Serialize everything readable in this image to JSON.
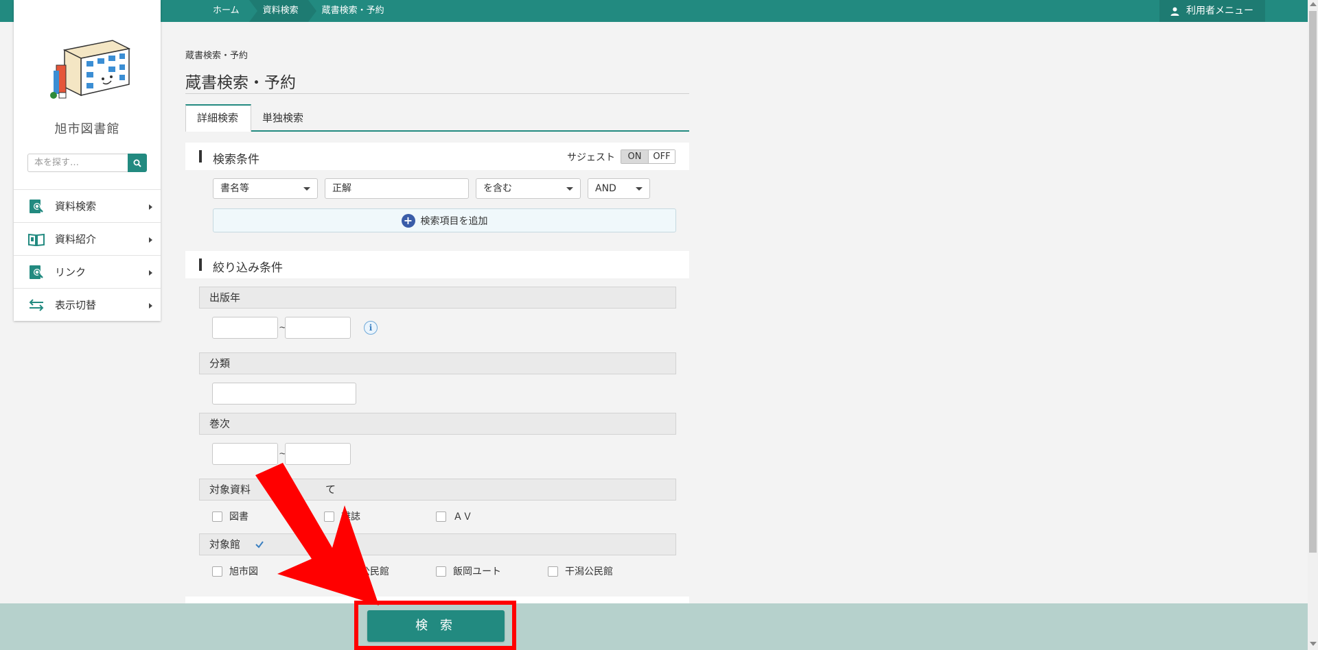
{
  "breadcrumb": [
    "ホーム",
    "資料検索",
    "蔵書検索・予約"
  ],
  "user_menu": {
    "label": "利用者メニュー",
    "icon": "user-icon"
  },
  "library": {
    "name": "旭市図書館"
  },
  "sidebar_search": {
    "placeholder": "本を探す…",
    "icon": "search-icon"
  },
  "sidebar_menu": [
    {
      "label": "資料検索",
      "icon": "book-search-icon"
    },
    {
      "label": "資料紹介",
      "icon": "open-book-icon"
    },
    {
      "label": "リンク",
      "icon": "link-search-icon"
    },
    {
      "label": "表示切替",
      "icon": "swap-arrows-icon"
    }
  ],
  "page": {
    "small_crumb": "蔵書検索・予約",
    "title": "蔵書検索・予約",
    "tabs": [
      "詳細検索",
      "単独検索"
    ]
  },
  "search_conditions": {
    "heading": "検索条件",
    "suggest_label": "サジェスト",
    "suggest_on": "ON",
    "suggest_off": "OFF",
    "field_select": "書名等",
    "keyword": "正解",
    "match_select": "を含む",
    "operator_select": "AND",
    "add_item": "検索項目を追加"
  },
  "filters": {
    "heading": "絞り込み条件",
    "publish_year": "出版年",
    "classification": "分類",
    "volume": "巻次",
    "material_type": "対象資料",
    "material_type_tail": "て",
    "materials": [
      "図書",
      "雑誌",
      "ＡＶ"
    ],
    "target_library": "対象館",
    "libraries": [
      "旭市図",
      "海上公民館",
      "飯岡ユート",
      "干潟公民館"
    ],
    "tilde": "~",
    "info": "i"
  },
  "search_button": "検 索",
  "colors": {
    "accent": "#228a80",
    "bottom_bar": "#b6d1cc",
    "highlight": "#ff0000"
  }
}
